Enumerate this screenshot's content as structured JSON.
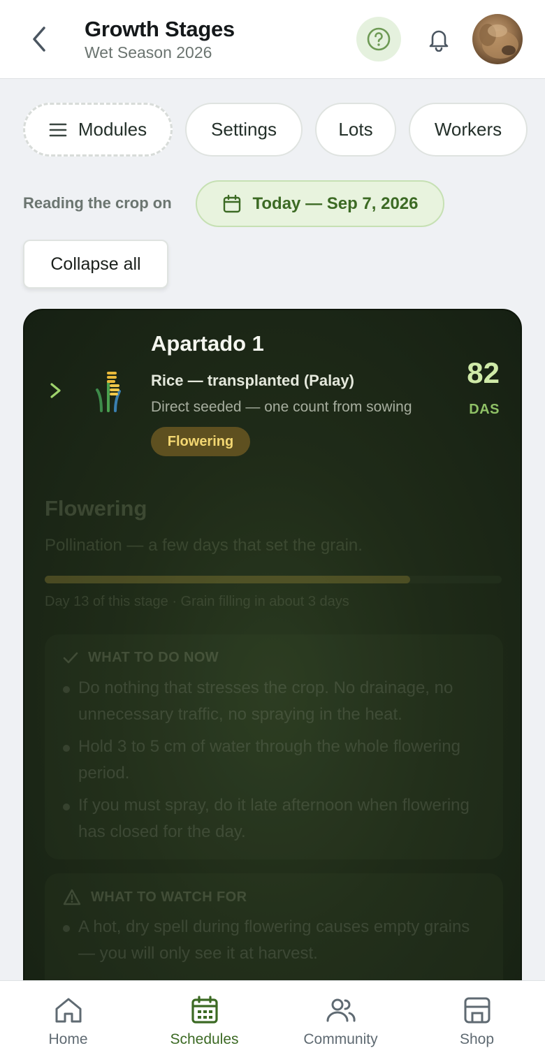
{
  "header": {
    "title": "Growth Stages",
    "subtitle": "Wet Season 2026"
  },
  "chips": {
    "modules": "Modules",
    "settings": "Settings",
    "lots": "Lots",
    "workers": "Workers"
  },
  "reading": {
    "label": "Reading the crop on",
    "date": "Today — Sep 7, 2026"
  },
  "collapse_label": "Collapse all",
  "card": {
    "lot_name": "Apartado 1",
    "crop": "Rice — transplanted (Palay)",
    "sowing_note": "Direct seeded — one count from sowing",
    "stage_badge": "Flowering",
    "das_value": "82",
    "das_label": "DAS",
    "stage_title": "Flowering",
    "stage_desc": "Pollination — a few days that set the grain.",
    "progress_fraction": 0.8,
    "progress_text": "Day 13 of this stage · Grain filling in about 3 days",
    "todo": {
      "heading": "WHAT TO DO NOW",
      "items": [
        "Do nothing that stresses the crop. No drainage, no unnecessary traffic, no spraying in the heat.",
        "Hold 3 to 5 cm of water through the whole flowering period.",
        "If you must spray, do it late afternoon when flowering has closed for the day."
      ]
    },
    "watch": {
      "heading": "WHAT TO WATCH FOR",
      "items": [
        "A hot, dry spell during flowering causes empty grains — you will only see it at harvest."
      ]
    }
  },
  "nav": {
    "home": "Home",
    "schedules": "Schedules",
    "community": "Community",
    "shop": "Shop"
  },
  "colors": {
    "accent": "#3c6a24",
    "card_bg": "#1f2b18",
    "badge_bg": "#5e5020",
    "badge_text": "#f3d772",
    "das_value": "#cfeaa8"
  }
}
